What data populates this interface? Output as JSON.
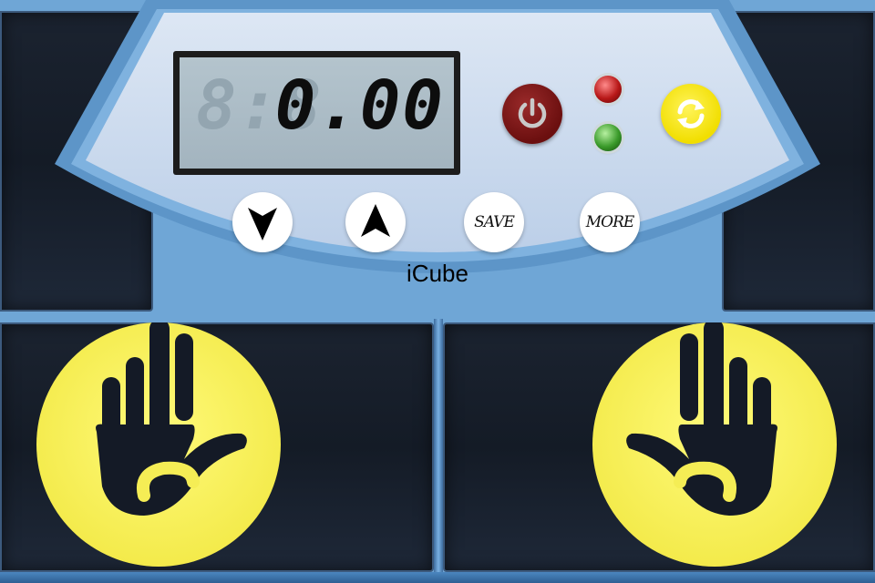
{
  "display": {
    "ghost_digits": "8:8",
    "time_value": "0.00"
  },
  "controls": {
    "power_icon": "power-icon",
    "reset_icon": "refresh-icon",
    "down_icon": "arrow-down-icon",
    "up_icon": "arrow-up-icon",
    "save_label": "SAVE",
    "more_label": "MORE"
  },
  "indicators": {
    "red_led": "#c01818",
    "green_led": "#3a9a2a"
  },
  "brand": {
    "name": "iCube"
  },
  "pads": {
    "left_icon": "left-hand-icon",
    "right_icon": "right-hand-icon"
  },
  "colors": {
    "panel": "#c9d9ee",
    "panel_border": "#6fa6d6",
    "pad": "#181f2b",
    "accent_yellow": "#f5ed55",
    "power_red": "#7a1414"
  }
}
